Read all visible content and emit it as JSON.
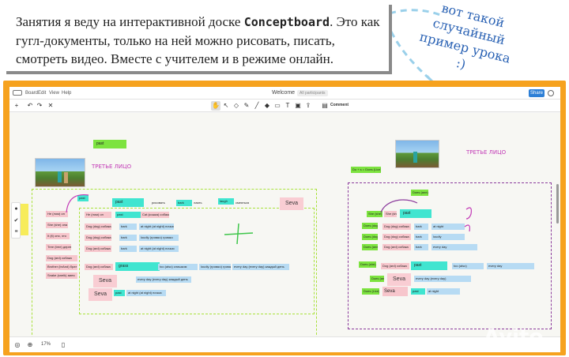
{
  "caption": {
    "line1_prefix": "Занятия я веду на интерактивной доске ",
    "brand": "Conceptboard",
    "line1_suffix": ".  Это как",
    "line2": "гугл-документы, только на ней можно рисовать, писать,",
    "line3": "смотреть видео.  Вместе с учителем и в режиме онлайн."
  },
  "side_note": "вот такой случайный пример урока :)",
  "app": {
    "menu": [
      "Board",
      "Edit",
      "View",
      "Help"
    ],
    "title": "Welcome",
    "participants": "All participants",
    "share_label": "Share",
    "toolbar": {
      "comment_label": "Comment"
    },
    "zoom": "17%"
  },
  "board": {
    "top_label": "past",
    "third_person_1": "ТРЕТЬЕ ЛИЦО",
    "third_person_2": "ТРЕТЬЕ ЛИЦО",
    "sticky_1": "Seva",
    "sticky_2": "Seva",
    "sticky_3": "Seva",
    "sticky_4": "Seva",
    "header_chips": [
      "past",
      "рисовать",
      "bark",
      "лаять",
      "laugh",
      "смеяться"
    ],
    "right_top_chip": "Do + s = Does (Lice)",
    "right_small_chip": "Does (ane)",
    "left_rows": [
      [
        "He (лом) он",
        "past",
        "Cat (кошка) собака"
      ],
      [
        "She (she) она",
        "bark",
        "Dog (dog) собака",
        "a"
      ],
      [
        "It (it) оно, это",
        "Dog (dog) собака",
        "loudly (громко) громко"
      ],
      [
        "Tree (tree) дерево",
        "Dog (ard) собака",
        "at night (at night) ночью"
      ]
    ],
    "right_rows": [
      [
        "She (she)",
        "past"
      ],
      [
        "Does (dog)",
        "Dog (dog) собака",
        "bark",
        "at night"
      ],
      [
        "Does (dog)",
        "Dog (dog) собака",
        "bark",
        "loudly"
      ],
      [
        "Does (ane)",
        "Dog (ard) собака",
        "bark",
        "every day"
      ],
      [
        "Does (she)",
        "Dog (ard) собака",
        "past",
        "too (also)",
        "every day"
      ],
      [
        "Does (ane)",
        "Seva",
        "every day (every day)"
      ],
      [
        "Does (Lice)",
        "Seva",
        "past",
        "at night"
      ]
    ],
    "lower_left": [
      "Dog (ard) собака",
      "Brother (brAnd) брат",
      "Snake (sneik) змея"
    ],
    "mid_rows": [
      [
        "Dog (ard) собака",
        "grass",
        "too (also) слишком",
        "loudly (громко) громко",
        "every day (every day) каждый день"
      ],
      [
        "Seva",
        "every day (every day) каждый день"
      ],
      [
        "Seva",
        "past",
        "at night (at night) ночью"
      ]
    ]
  }
}
